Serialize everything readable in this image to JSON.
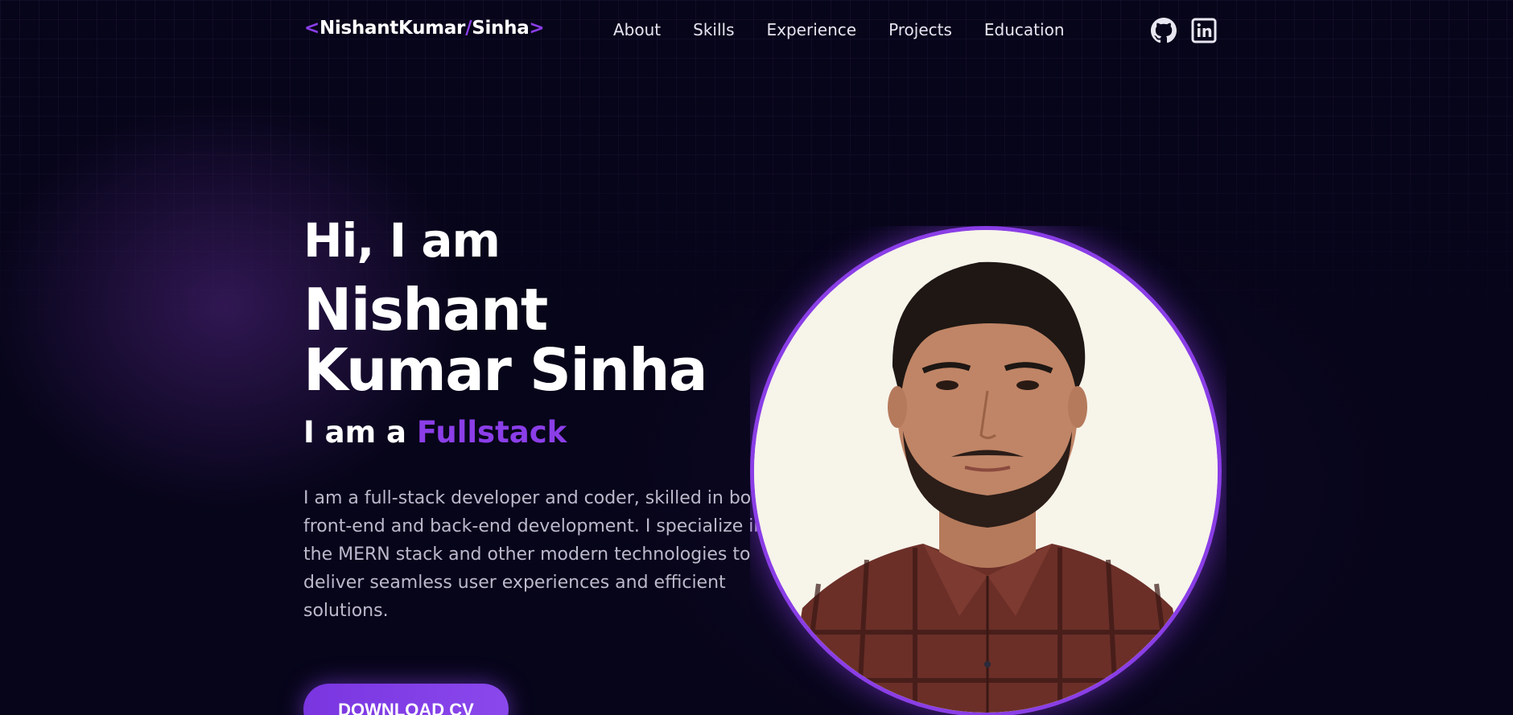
{
  "nav": {
    "logo": {
      "bracket_open": "<",
      "first": "NishantKumar",
      "slash": "/",
      "last": "Sinha",
      "bracket_close": ">"
    },
    "links": [
      "About",
      "Skills",
      "Experience",
      "Projects",
      "Education"
    ],
    "social": [
      {
        "icon": "github-icon"
      },
      {
        "icon": "linkedin-icon"
      }
    ]
  },
  "hero": {
    "greeting": "Hi, I am",
    "name_line1": "Nishant",
    "name_line2": "Kumar Sinha",
    "role_prefix": "I am a",
    "role_word": "Fullstack",
    "description": "I am a full-stack developer and coder, skilled in both front-end and back-end development. I specialize in the MERN stack and other modern technologies to deliver seamless user experiences and efficient solutions.",
    "cta_label": "DOWNLOAD CV"
  },
  "colors": {
    "accent": "#8b3ee8",
    "background": "#07051a",
    "text_muted": "#bdb9cc"
  }
}
